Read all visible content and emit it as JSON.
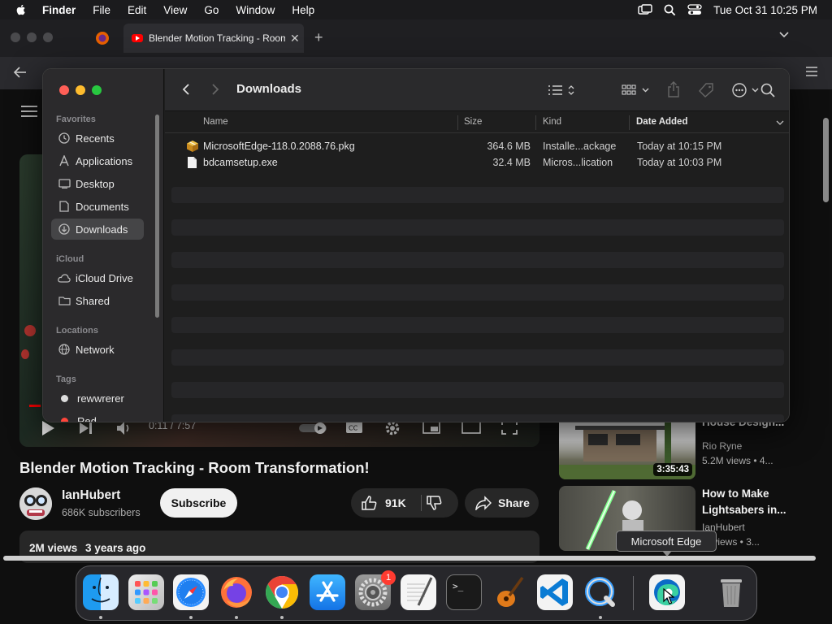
{
  "menubar": {
    "app_name": "Finder",
    "menus": [
      "File",
      "Edit",
      "View",
      "Go",
      "Window",
      "Help"
    ],
    "clock": "Tue Oct 31  10:25 PM"
  },
  "browser": {
    "tab_title": "Blender Motion Tracking - Room Transformation!",
    "new_tab": "+"
  },
  "youtube": {
    "time": "0:11 / 7:57",
    "video_title": "Blender Motion Tracking - Room Transformation!",
    "channel": "IanHubert",
    "subscribers": "686K subscribers",
    "subscribe": "Subscribe",
    "likes": "91K",
    "share": "Share",
    "views": "2M views",
    "age": "3 years ago",
    "recommended": [
      {
        "title": "House Design...",
        "channel": "Rio Ryne",
        "meta": "5.2M views  •  4...",
        "duration": "3:35:43"
      },
      {
        "title": "How to Make Lightsabers in...",
        "channel": "IanHubert",
        "meta": "M views  •  3..."
      }
    ]
  },
  "finder": {
    "folder_title": "Downloads",
    "sidebar": {
      "favorites_label": "Favorites",
      "favorites": [
        "Recents",
        "Applications",
        "Desktop",
        "Documents",
        "Downloads"
      ],
      "icloud_label": "iCloud",
      "icloud": [
        "iCloud Drive",
        "Shared"
      ],
      "locations_label": "Locations",
      "locations": [
        "Network"
      ],
      "tags_label": "Tags",
      "tags": [
        "rewwrerer",
        "Red"
      ]
    },
    "columns": {
      "name": "Name",
      "size": "Size",
      "kind": "Kind",
      "date": "Date Added"
    },
    "files": [
      {
        "name": "MicrosoftEdge-118.0.2088.76.pkg",
        "size": "364.6 MB",
        "kind": "Installe...ackage",
        "date": "Today at 10:15 PM"
      },
      {
        "name": "bdcamsetup.exe",
        "size": "32.4 MB",
        "kind": "Micros...lication",
        "date": "Today at 10:03 PM"
      }
    ]
  },
  "tooltip": "Microsoft Edge",
  "dock": {
    "badge": "1",
    "apps": [
      "finder",
      "launchpad",
      "safari",
      "firefox",
      "chrome",
      "app-store",
      "system-settings",
      "textedit",
      "terminal",
      "garageband",
      "vscode",
      "quicktime",
      "edge",
      "trash"
    ]
  },
  "colors": {
    "accent_red": "#ff0000",
    "finder_bg": "#1e1e1e",
    "sidebar_bg": "#2b2a2c"
  }
}
